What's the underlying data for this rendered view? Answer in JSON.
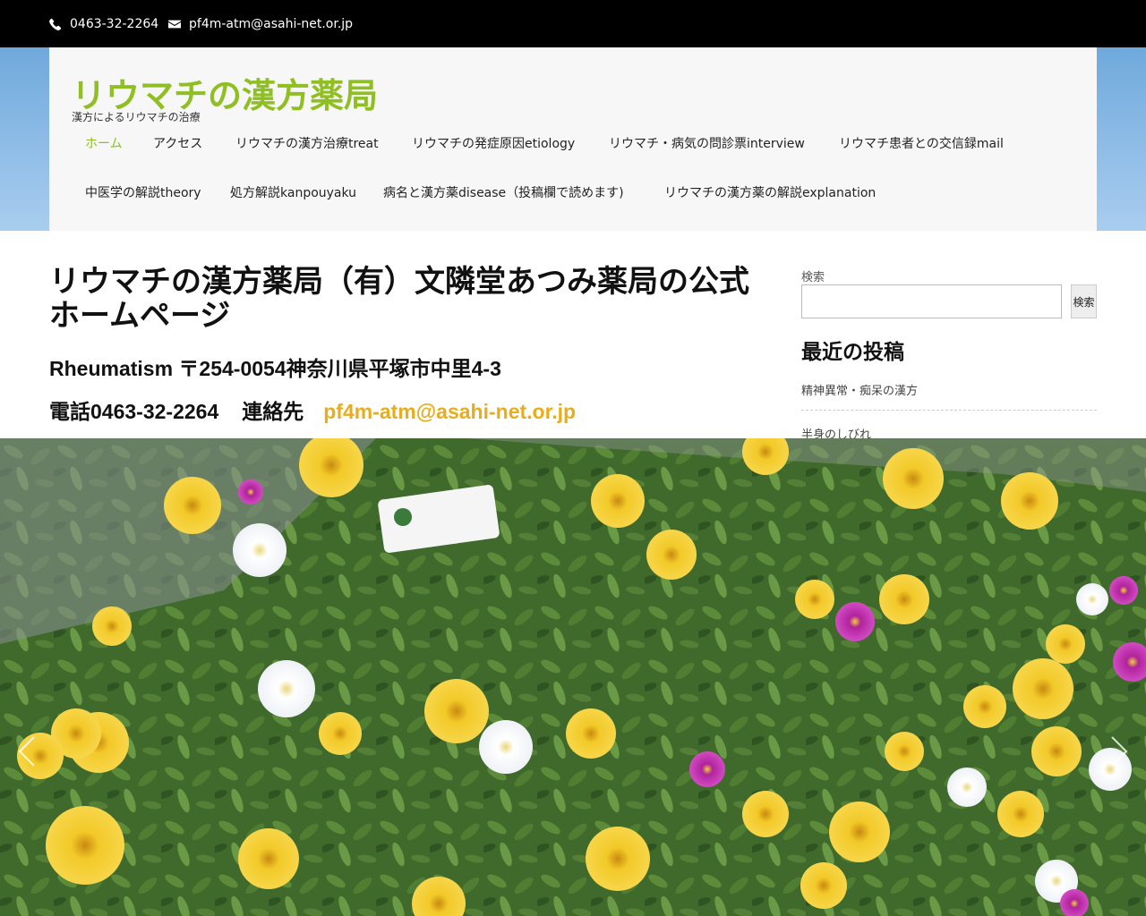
{
  "topbar": {
    "phone": "0463-32-2264",
    "email": "pf4m-atm@asahi-net.or.jp",
    "phone_icon": "phone-icon",
    "mail_icon": "envelope-icon"
  },
  "header": {
    "site_title": "リウマチの漢方薬局",
    "tagline": "漢方によるリウマチの治療"
  },
  "nav": {
    "items": [
      {
        "label": "ホーム",
        "active": true
      },
      {
        "label": "アクセス"
      },
      {
        "label": "リウマチの漢方治療treat"
      },
      {
        "label": "リウマチの発症原因etiology"
      },
      {
        "label": "リウマチ・病気の問診票interview"
      },
      {
        "label": "リウマチ患者との交信録mail"
      },
      {
        "label": "中医学の解説theory"
      },
      {
        "label": "処方解説kanpouyaku"
      },
      {
        "label": "病名と漢方薬disease（投稿欄で読めます)"
      },
      {
        "label": "リウマチの漢方薬の解説explanation"
      }
    ]
  },
  "main": {
    "title": "リウマチの漢方薬局（有）文隣堂あつみ薬局の公式ホームページ",
    "address": "Rheumatism 〒254-0054神奈川県平塚市中里4-3",
    "tel_label": "電話0463-32-2264",
    "contact_label": "連絡先",
    "email": "pf4m-atm@asahi-net.or.jp"
  },
  "sidebar": {
    "search_label": "検索",
    "search_value": "",
    "search_button": "検索",
    "recent_title": "最近の投稿",
    "recent_posts": [
      "精神異常・痴呆の漢方",
      "半身のしびれ"
    ]
  },
  "slider": {
    "prev_icon": "chevron-left-icon",
    "next_icon": "chevron-right-icon"
  },
  "colors": {
    "accent_green": "#8fbf22",
    "email_gold": "#e7ad1c",
    "topbar_bg": "#000000"
  }
}
